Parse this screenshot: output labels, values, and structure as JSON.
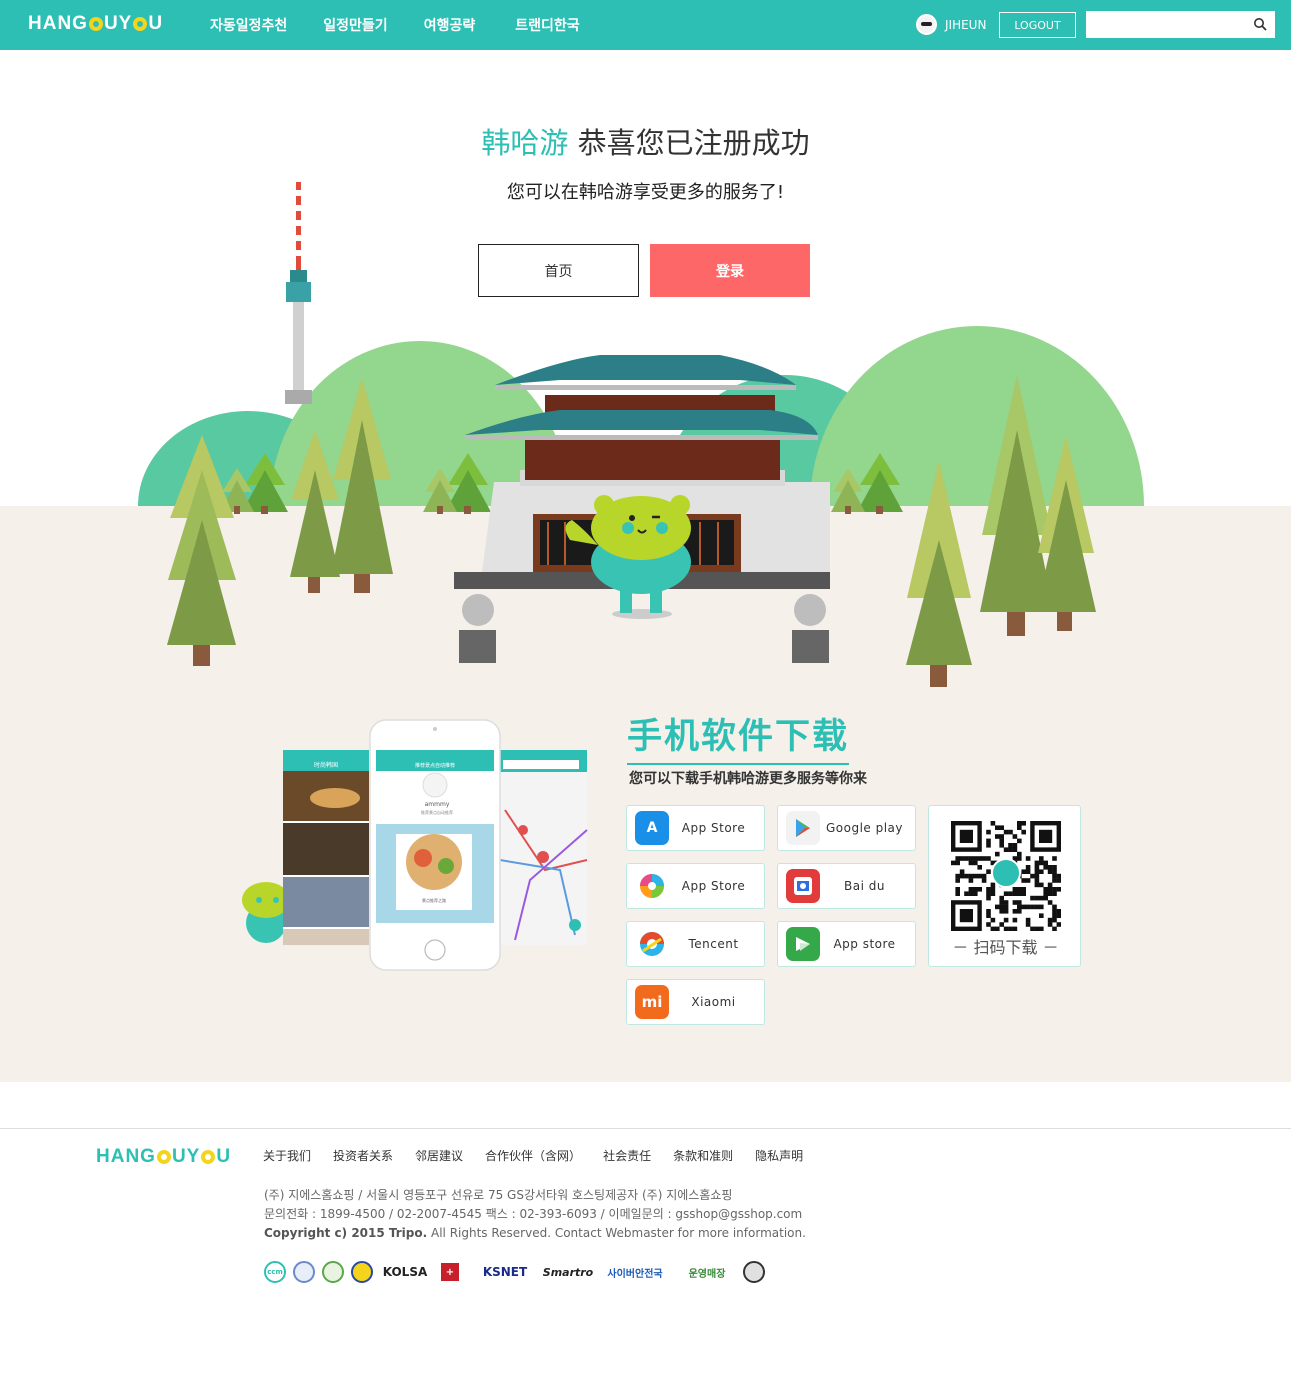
{
  "header": {
    "logo": "HANGOUYOU",
    "nav": [
      "자동일정추천",
      "일정만들기",
      "여행공략",
      "트랜디한국"
    ],
    "username": "JIHEUN",
    "logout": "LOGOUT",
    "search_placeholder": ""
  },
  "hero": {
    "brand": "韩哈游",
    "title": " 恭喜您已注册成功",
    "subtitle": "您可以在韩哈游享受更多的服务了!",
    "home_button": "首页",
    "login_button": "登录"
  },
  "app": {
    "title": "手机软件下载",
    "subtitle": "您可以下载手机韩哈游更多服务等你来",
    "stores": [
      {
        "label": "App Store",
        "icon": "app-store-icon",
        "color": "#1a8fe8"
      },
      {
        "label": "Google play",
        "icon": "google-play-icon",
        "color": "#e8e8e8"
      },
      {
        "label": "App Store",
        "icon": "color-ring-icon",
        "color": "#ff9c1a"
      },
      {
        "label": "Bai du",
        "icon": "baidu-icon",
        "color": "#e23b3b"
      },
      {
        "label": "Tencent",
        "icon": "tencent-icon",
        "color": "#e24b2b"
      },
      {
        "label": "App store",
        "icon": "wandoujia-icon",
        "color": "#35a94a"
      },
      {
        "label": "Xiaomi",
        "icon": "xiaomi-icon",
        "color": "#f26b1d"
      }
    ],
    "qr_label": "－ 扫码下载 －",
    "phone_screens": {
      "left_title": "时尚韩国",
      "center_title": "推荐景点自动推荐",
      "center_name": "ammmy",
      "center_caption": "推荐景点自动推荐",
      "center_card_text": "景点推荐之路"
    }
  },
  "footer": {
    "logo": "HANGOUYOU",
    "links": [
      "关于我们",
      "投资者关系",
      "邻居建议",
      "合作伙伴（含网）",
      "社会责任",
      "条款和准则",
      "隐私声明"
    ],
    "address": "(주) 지에스홈쇼핑  / 서울시 영등포구 선유로 75 GS강서타워 호스팅제공자 (주) 지에스홈쇼핑",
    "contact": "문의전화 : 1899-4500 / 02-2007-4545 팩스 : 02-393-6093 / 이메일문의 : gsshop@gsshop.com",
    "copyright_bold": "Copyright c) 2015 Tripo.",
    "copyright_rest": " All Rights Reserved. Contact Webmaster for more information.",
    "badges": [
      "ccm",
      "",
      "",
      "",
      "KOLSA",
      "",
      "KSNET",
      "Smartro",
      "사이버안전국",
      "운영매장",
      ""
    ]
  }
}
